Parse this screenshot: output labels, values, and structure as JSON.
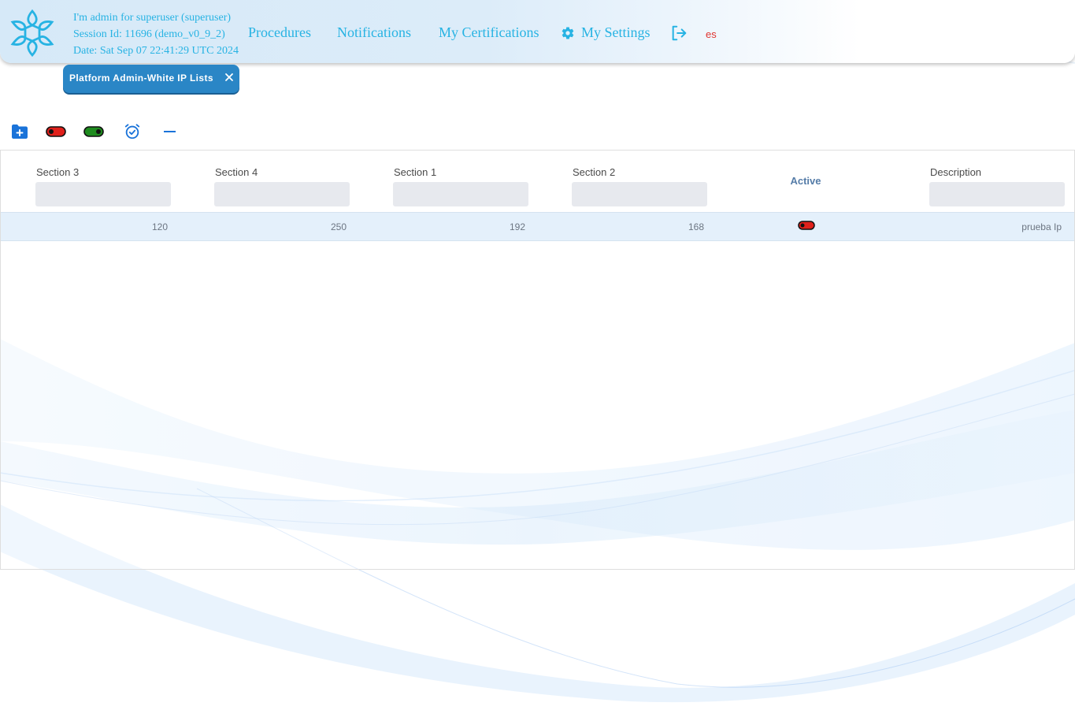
{
  "header": {
    "session_lines": [
      "I'm admin for superuser (superuser)",
      "Session Id: 11696 (demo_v0_9_2)",
      "Date: Sat Sep 07 22:41:29 UTC 2024"
    ],
    "nav": {
      "procedures": "Procedures",
      "notifications": "Notifications",
      "certifications": "My Certifications",
      "settings": "My Settings"
    },
    "language": "es"
  },
  "tab": {
    "label": "Platform Admin-White IP Lists"
  },
  "toolbar": {
    "icons": [
      "folder-add-icon",
      "toggle-off-icon",
      "toggle-on-icon",
      "alarm-check-icon",
      "minus-icon"
    ]
  },
  "table": {
    "columns": [
      "Section 3",
      "Section 4",
      "Section 1",
      "Section 2",
      "Active",
      "Description"
    ],
    "rows": [
      {
        "section3": "120",
        "section4": "250",
        "section1": "192",
        "section2": "168",
        "active": false,
        "description": "prueba Ip"
      }
    ]
  },
  "colors": {
    "accent": "#27b3e3",
    "tab": "#2a86c6",
    "language": "#e0342f",
    "toggle_off": "#e0201b",
    "toggle_on": "#1e8b1e",
    "row_highlight": "#e4f0fb"
  }
}
